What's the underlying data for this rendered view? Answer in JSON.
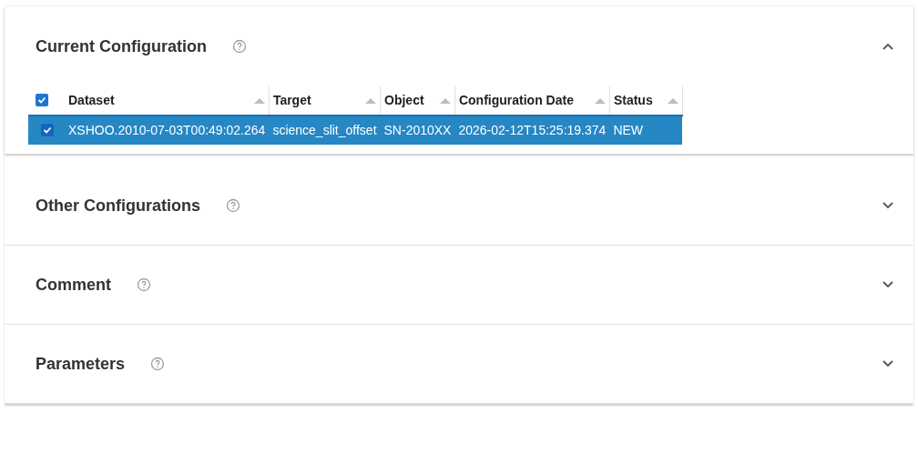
{
  "sections": [
    {
      "title": "Current Configuration",
      "expanded": true,
      "table": {
        "all_checked": true,
        "columns": [
          "Dataset",
          "Target",
          "Object",
          "Configuration Date",
          "Status"
        ],
        "rows": [
          {
            "selected": true,
            "checked": true,
            "cells": [
              "XSHOO.2010-07-03T00:49:02.264",
              "science_slit_offset",
              "SN-2010XX",
              "2026-02-12T15:25:19.374",
              "NEW"
            ]
          }
        ]
      }
    },
    {
      "title": "Other Configurations",
      "expanded": false
    },
    {
      "title": "Comment",
      "expanded": false
    },
    {
      "title": "Parameters",
      "expanded": false
    }
  ]
}
